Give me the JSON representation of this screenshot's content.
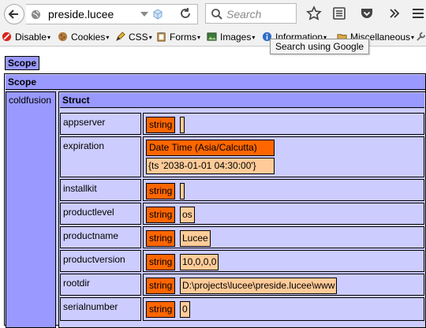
{
  "browser": {
    "url": "preside.lucee",
    "search_placeholder": "Search",
    "tooltip": "Search using Google"
  },
  "devbar": {
    "items": [
      {
        "label": "Disable",
        "icon": "no-entry-icon"
      },
      {
        "label": "Cookies",
        "icon": "cookie-icon"
      },
      {
        "label": "CSS",
        "icon": "pencil-icon"
      },
      {
        "label": "Forms",
        "icon": "clipboard-icon"
      },
      {
        "label": "Images",
        "icon": "image-icon"
      },
      {
        "label": "Information",
        "icon": "info-icon"
      },
      {
        "label": "Miscellaneous",
        "icon": "folder-icon"
      }
    ]
  },
  "dump": {
    "scope_label_1": "Scope",
    "scope_label_2": "Scope",
    "key": "coldfusion",
    "struct_label": "Struct",
    "rows": [
      {
        "key": "appserver",
        "type": "string",
        "value": ""
      },
      {
        "key": "expiration",
        "type": "Date Time (Asia/Calcutta)",
        "value": "{ts '2038-01-01 04:30:00'}"
      },
      {
        "key": "installkit",
        "type": "string",
        "value": ""
      },
      {
        "key": "productlevel",
        "type": "string",
        "value": "os"
      },
      {
        "key": "productname",
        "type": "string",
        "value": "Lucee"
      },
      {
        "key": "productversion",
        "type": "string",
        "value": "10,0,0,0"
      },
      {
        "key": "rootdir",
        "type": "string",
        "value": "D:\\projects\\lucee\\preside.lucee\\www"
      },
      {
        "key": "serialnumber",
        "type": "string",
        "value": "0"
      }
    ]
  }
}
